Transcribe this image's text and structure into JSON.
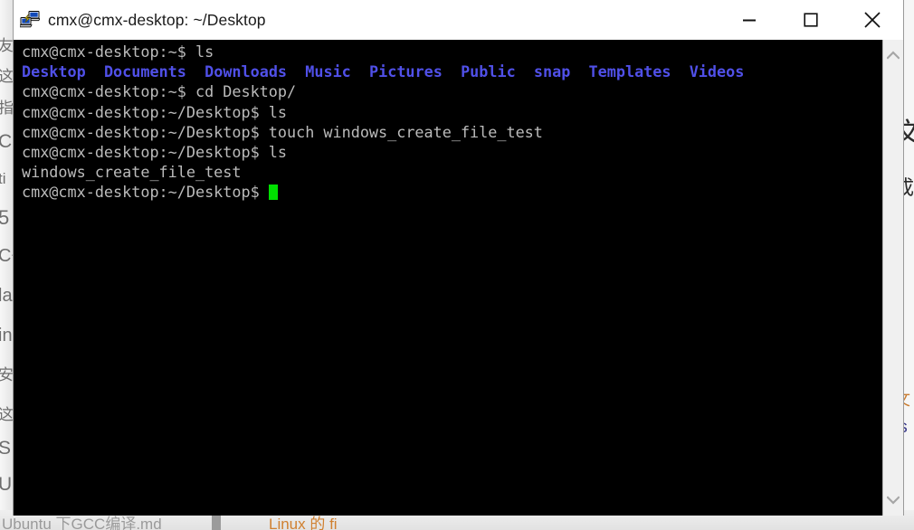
{
  "window": {
    "title": "cmx@cmx-desktop: ~/Desktop",
    "icon": "putty-remote-session-icon",
    "controls": {
      "minimize_label": "—",
      "maximize_label": "□",
      "close_label": "✕"
    }
  },
  "terminal": {
    "prompt_home": "cmx@cmx-desktop:~$ ",
    "prompt_desktop": "cmx@cmx-desktop:~/Desktop$ ",
    "foreground_color": "#bbbbbb",
    "background_color": "#000000",
    "directory_color": "#5050e8",
    "cursor_color": "#00e000",
    "lines": [
      {
        "type": "prompt",
        "prompt": "cmx@cmx-desktop:~$ ",
        "command": "ls"
      },
      {
        "type": "ls-output",
        "entries": [
          "Desktop",
          "Documents",
          "Downloads",
          "Music",
          "Pictures",
          "Public",
          "snap",
          "Templates",
          "Videos"
        ]
      },
      {
        "type": "prompt",
        "prompt": "cmx@cmx-desktop:~$ ",
        "command": "cd Desktop/"
      },
      {
        "type": "prompt",
        "prompt": "cmx@cmx-desktop:~/Desktop$ ",
        "command": "ls"
      },
      {
        "type": "prompt",
        "prompt": "cmx@cmx-desktop:~/Desktop$ ",
        "command": "touch windows_create_file_test"
      },
      {
        "type": "prompt",
        "prompt": "cmx@cmx-desktop:~/Desktop$ ",
        "command": "ls"
      },
      {
        "type": "output",
        "text": "windows_create_file_test"
      },
      {
        "type": "prompt-cursor",
        "prompt": "cmx@cmx-desktop:~/Desktop$ ",
        "command": ""
      }
    ],
    "rendered": {
      "line1": "cmx@cmx-desktop:~$ ls",
      "line2_entries": "Desktop  Documents  Downloads  Music  Pictures  Public  snap  Templates  Videos",
      "line3": "cmx@cmx-desktop:~$ cd Desktop/",
      "line4": "cmx@cmx-desktop:~/Desktop$ ls",
      "line5": "cmx@cmx-desktop:~/Desktop$ touch windows_create_file_test",
      "line6": "cmx@cmx-desktop:~/Desktop$ ls",
      "line7": "windows_create_file_test",
      "line8": "cmx@cmx-desktop:~/Desktop$ "
    },
    "entries": {
      "e0": "Desktop",
      "e1": "Documents",
      "e2": "Downloads",
      "e3": "Music",
      "e4": "Pictures",
      "e5": "Public",
      "e6": "snap",
      "e7": "Templates",
      "e8": "Videos"
    },
    "scrollbar": {
      "up_arrow": "⌃",
      "down_arrow": "⌄"
    }
  },
  "background": {
    "left_fragments": [
      "友",
      "这",
      "指",
      "C",
      "ti",
      "5",
      "C+",
      "la",
      "in",
      "安",
      "这",
      "S",
      "U",
      "U"
    ],
    "right_fragments": [
      "文",
      "成",
      "≡",
      "文",
      "/s"
    ],
    "bottom_tabs": [
      {
        "label": "Ubuntu 下GCC编译.md",
        "color": "#9a9a9a"
      },
      {
        "label": "Linux 的 fi",
        "color": "#d08030"
      }
    ]
  }
}
